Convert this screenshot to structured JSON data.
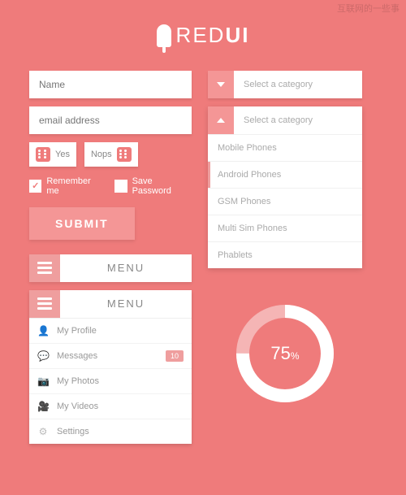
{
  "watermark": "互联网的一些事",
  "brand": {
    "text_light": "RED",
    "text_bold": "UI"
  },
  "form": {
    "name_placeholder": "Name",
    "email_placeholder": "email address",
    "yes_label": "Yes",
    "no_label": "Nops",
    "remember": "Remember me",
    "save_pw": "Save Password",
    "submit": "SUBMIT"
  },
  "menu": {
    "label": "MENU",
    "items": [
      {
        "icon": "👤",
        "label": "My Profile"
      },
      {
        "icon": "💬",
        "label": "Messages",
        "badge": "10"
      },
      {
        "icon": "📷",
        "label": "My Photos"
      },
      {
        "icon": "🎥",
        "label": "My Videos"
      },
      {
        "icon": "⚙",
        "label": "Settings"
      }
    ]
  },
  "select": {
    "placeholder": "Select a category",
    "options": [
      "Mobile Phones",
      "Android Phones",
      "GSM Phones",
      "Multi Sim Phones",
      "Phablets"
    ],
    "active_index": 1
  },
  "chart_data": {
    "type": "pie",
    "title": "",
    "value": 75,
    "max": 100,
    "display": "75",
    "unit": "%",
    "colors": {
      "track": "#f5b5b5",
      "fill": "#ffffff"
    }
  }
}
